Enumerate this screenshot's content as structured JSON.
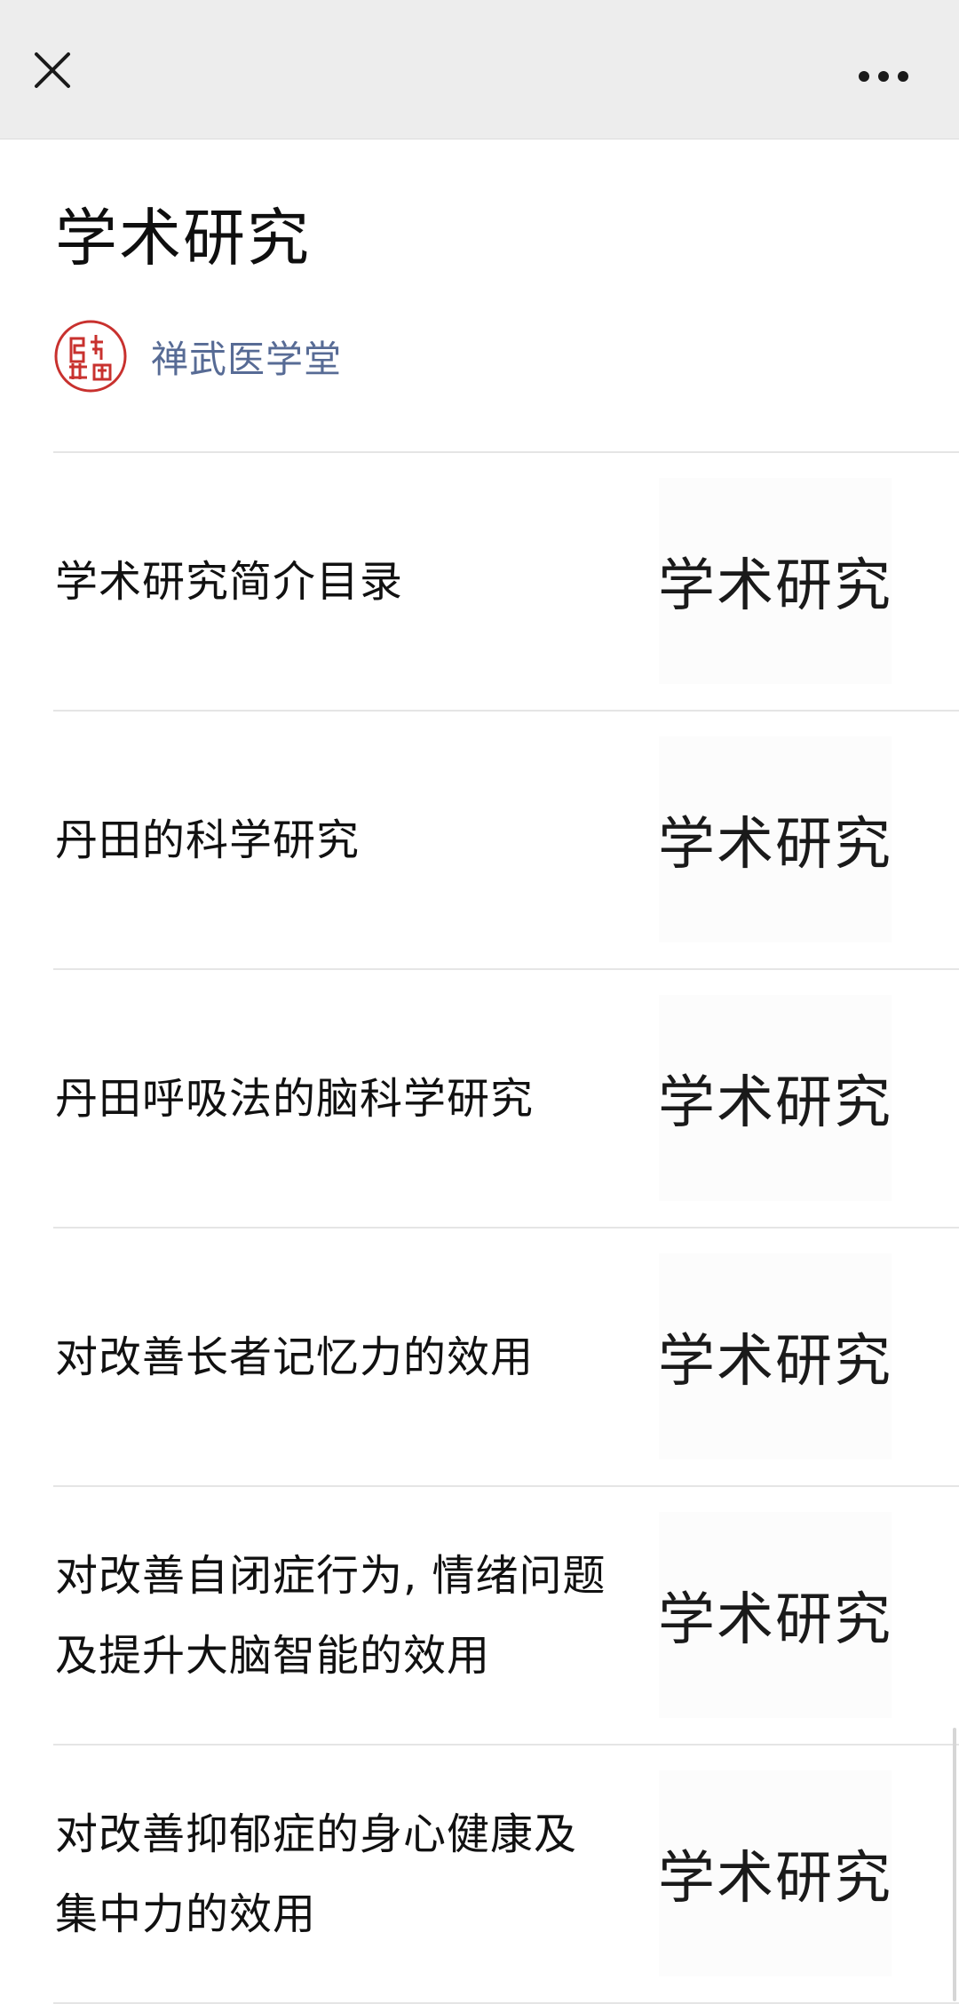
{
  "header": {
    "close_icon": "close-icon",
    "more_icon": "more-dots-icon",
    "background": "#ededed"
  },
  "article": {
    "title": "学术研究",
    "author": {
      "name": "禅武医学堂",
      "name_color": "#576b95",
      "avatar": "red-seal-avatar"
    }
  },
  "items": [
    {
      "lines": [
        "学术研究简介目录"
      ],
      "thumb_text": "学术研究"
    },
    {
      "lines": [
        "丹田的科学研究"
      ],
      "thumb_text": "学术研究"
    },
    {
      "lines": [
        "丹田呼吸法的脑科学研究"
      ],
      "thumb_text": "学术研究"
    },
    {
      "lines": [
        "对改善长者记忆力的效用"
      ],
      "thumb_text": "学术研究"
    },
    {
      "lines": [
        "对改善自闭症行为, 情绪问题",
        "及提升大脑智能的效用"
      ],
      "thumb_text": "学术研究"
    },
    {
      "lines": [
        "对改善抑郁症的身心健康及",
        "集中力的效用"
      ],
      "thumb_text": "学术研究"
    }
  ]
}
